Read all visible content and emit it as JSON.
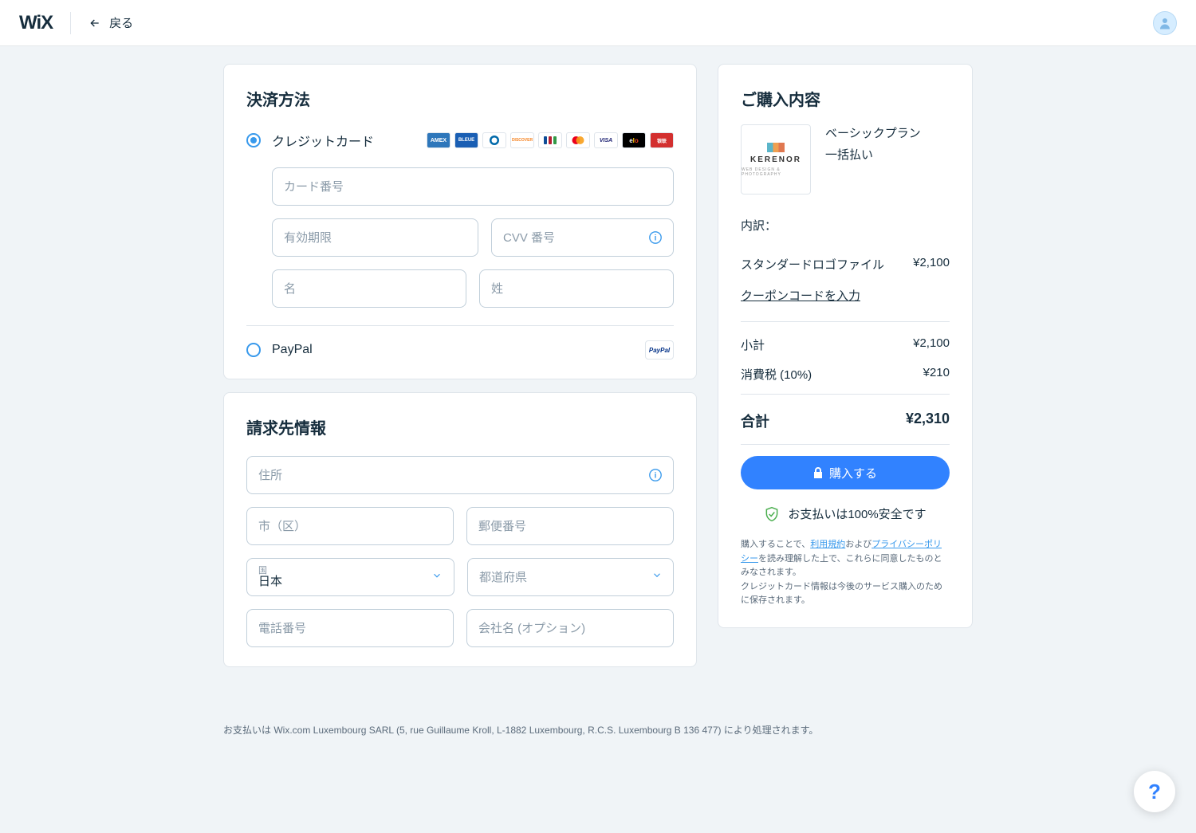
{
  "header": {
    "back_label": "戻る"
  },
  "payment": {
    "title": "決済方法",
    "cc_label": "クレジットカード",
    "paypal_label": "PayPal",
    "card_number_ph": "カード番号",
    "expiry_ph": "有効期限",
    "cvv_ph": "CVV 番号",
    "first_name_ph": "名",
    "last_name_ph": "姓"
  },
  "billing": {
    "title": "請求先情報",
    "address_ph": "住所",
    "city_ph": "市（区）",
    "postal_ph": "郵便番号",
    "country_label": "国",
    "country_value": "日本",
    "prefecture_ph": "都道府県",
    "phone_ph": "電話番号",
    "company_ph": "会社名 (オプション)"
  },
  "summary": {
    "title": "ご購入内容",
    "plan_name": "ベーシックプラン",
    "plan_term": "一括払い",
    "logo_text": "KERENOR",
    "logo_sub": "WEB DESIGN & PHOTOGRAPHY",
    "breakdown_label": "内訳：",
    "item_label": "スタンダードロゴファイル",
    "item_price": "¥2,100",
    "coupon_label": "クーポンコードを入力",
    "subtotal_label": "小計",
    "subtotal_value": "¥2,100",
    "tax_label": "消費税 (10%)",
    "tax_value": "¥210",
    "total_label": "合計",
    "total_value": "¥2,310",
    "buy_label": "購入する",
    "safe_label": "お支払いは100%安全です",
    "legal1_pre": "購入することで、",
    "legal1_link1": "利用規約",
    "legal1_mid": "および",
    "legal1_link2": "プライバシーポリシー",
    "legal1_post": "を読み理解した上で、これらに同意したものとみなされます。",
    "legal2": "クレジットカード情報は今後のサービス購入のために保存されます。"
  },
  "footer": {
    "note": "お支払いは Wix.com Luxembourg SARL (5, rue Guillaume Kroll, L-1882 Luxembourg, R.C.S. Luxembourg B 136 477) により処理されます。"
  },
  "help": {
    "label": "?"
  }
}
